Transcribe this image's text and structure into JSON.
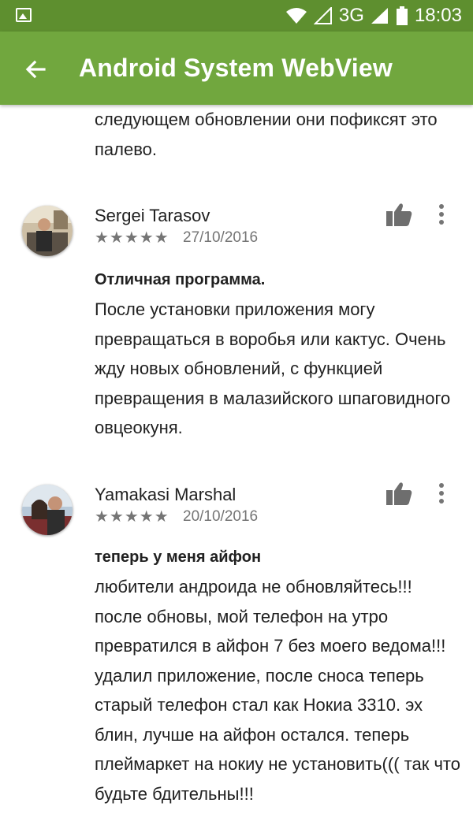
{
  "status_bar": {
    "network": "3G",
    "time": "18:03"
  },
  "app_bar": {
    "title": "Android System WebView"
  },
  "snippet": {
    "text": "следующем обновлении они пофиксят это палево."
  },
  "reviews": [
    {
      "author": "Sergei Tarasov",
      "rating": 5,
      "stars": "★★★★★",
      "date": "27/10/2016",
      "title": "Отличная программа.",
      "body": "После установки приложения могу превращаться в воробья или кактус. Очень жду новых обновлений, с функцией превращения в малазийского шпаговидного овцеокуня."
    },
    {
      "author": "Yamakasi Marshal",
      "rating": 5,
      "stars": "★★★★★",
      "date": "20/10/2016",
      "title": "теперь у меня айфон",
      "body": "любители андроида не обновляйтесь!!! после обновы, мой телефон на утро превратился в айфон 7 без моего ведома!!! удалил приложение, после сноса теперь старый телефон стал как Нокиа 3310. эх блин, лучше на айфон остался. теперь плеймаркет на нокиу не установить((( так что будьте бдительны!!!"
    }
  ],
  "colors": {
    "app_bar": "#71a73e",
    "status_bar": "#5e8f2f",
    "secondary_text": "#757575"
  },
  "icons": [
    "image-notification-icon",
    "wifi-icon",
    "signal-icon",
    "battery-icon",
    "back-arrow-icon",
    "thumbs-up-icon",
    "more-vert-icon"
  ]
}
